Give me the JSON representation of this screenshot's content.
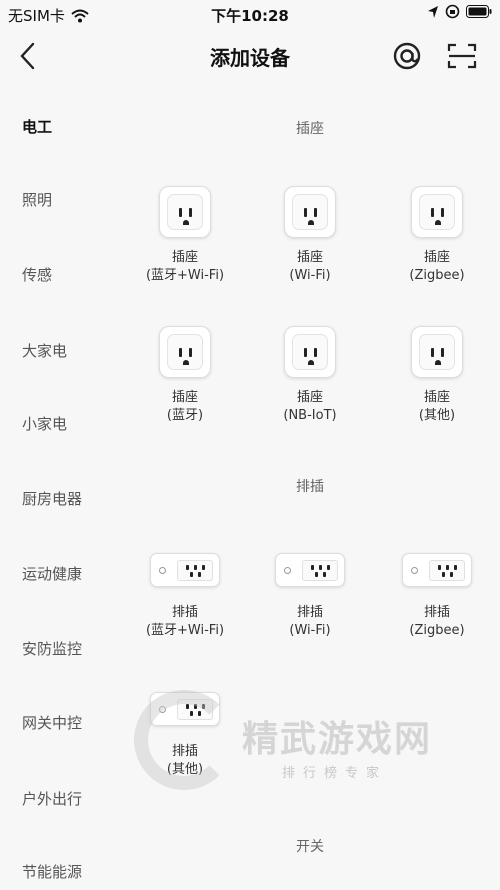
{
  "status_bar": {
    "carrier": "无SIM卡",
    "time": "下午10:28"
  },
  "header": {
    "title": "添加设备"
  },
  "sidebar": {
    "items": [
      {
        "label": "电工",
        "active": true
      },
      {
        "label": "照明"
      },
      {
        "label": "传感"
      },
      {
        "label": "大家电"
      },
      {
        "label": "小家电"
      },
      {
        "label": "厨房电器"
      },
      {
        "label": "运动健康"
      },
      {
        "label": "安防监控"
      },
      {
        "label": "网关中控"
      },
      {
        "label": "户外出行"
      },
      {
        "label": "节能能源"
      }
    ]
  },
  "sections": {
    "socket": {
      "title": "插座",
      "devices": [
        {
          "name": "插座",
          "sub": "(蓝牙+Wi-Fi)"
        },
        {
          "name": "插座",
          "sub": "(Wi-Fi)"
        },
        {
          "name": "插座",
          "sub": "(Zigbee)"
        },
        {
          "name": "插座",
          "sub": "(蓝牙)"
        },
        {
          "name": "插座",
          "sub": "(NB-IoT)"
        },
        {
          "name": "插座",
          "sub": "(其他)"
        }
      ]
    },
    "strip": {
      "title": "排插",
      "devices": [
        {
          "name": "排插",
          "sub": "(蓝牙+Wi-Fi)"
        },
        {
          "name": "排插",
          "sub": "(Wi-Fi)"
        },
        {
          "name": "排插",
          "sub": "(Zigbee)"
        },
        {
          "name": "排插",
          "sub": "(其他)"
        }
      ]
    },
    "switch": {
      "title": "开关"
    }
  },
  "watermark": {
    "title": "精武游戏网",
    "subtitle": "排行榜专家"
  }
}
